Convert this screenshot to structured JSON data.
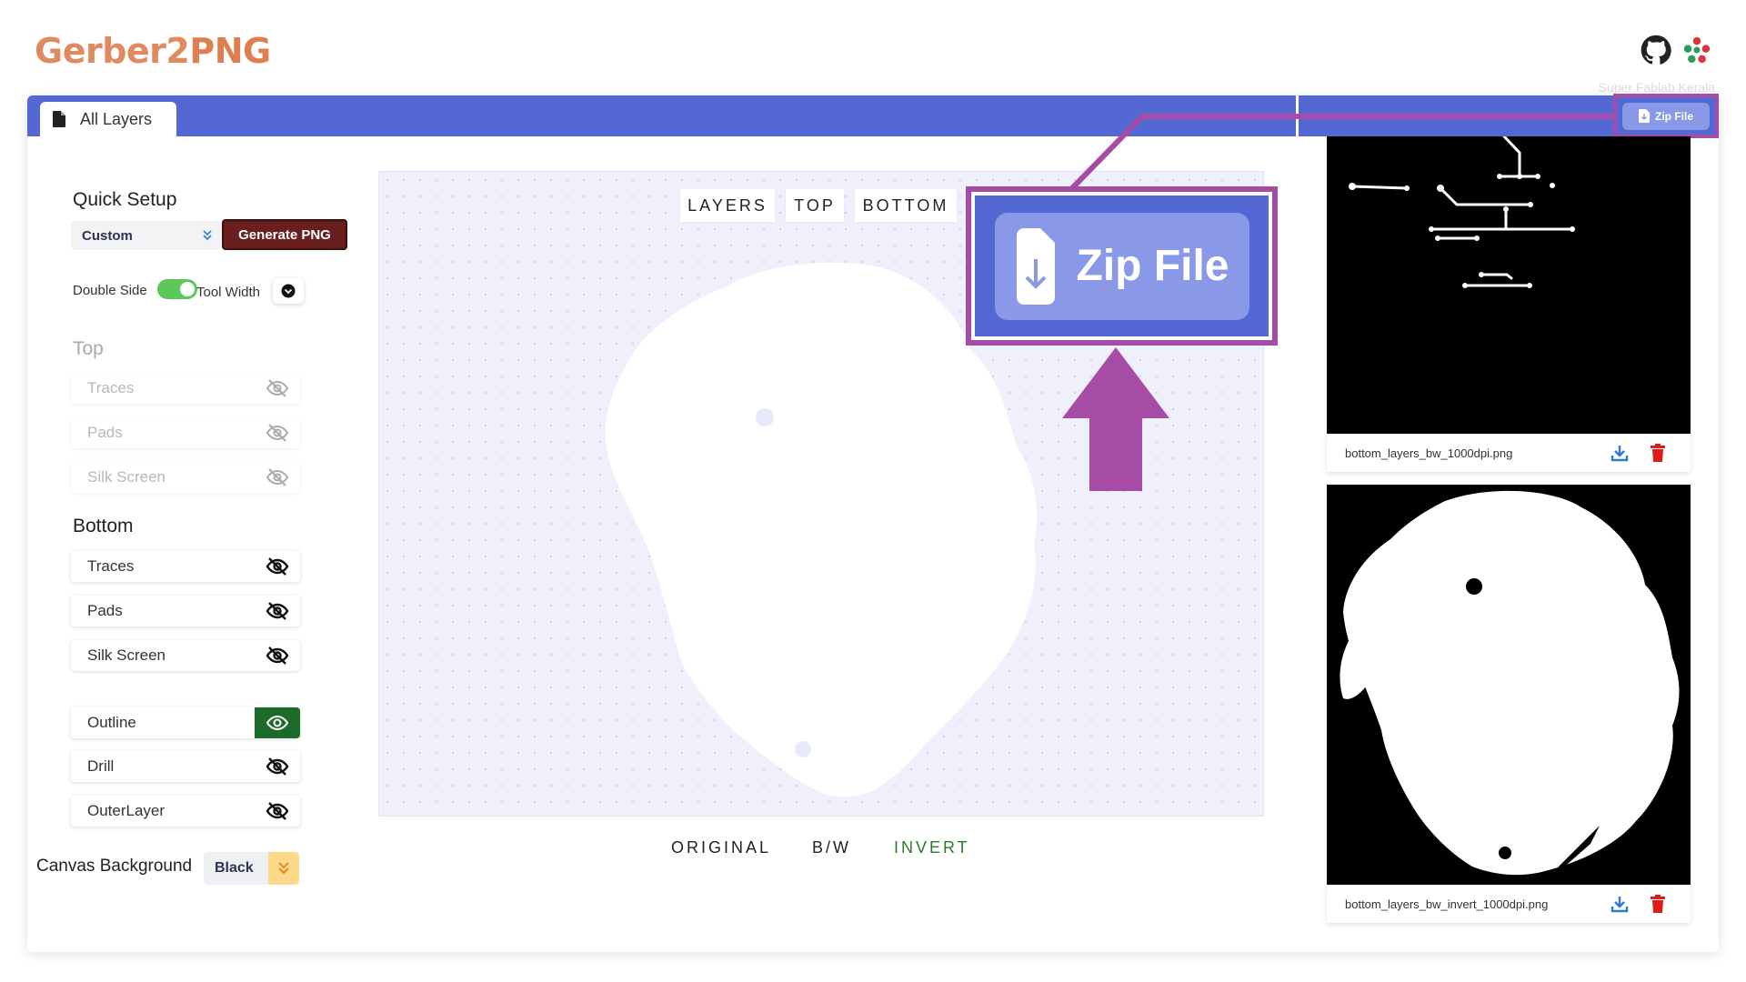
{
  "app": {
    "title_part1": "Gerber",
    "title_part2": "2",
    "title_part3": "PNG"
  },
  "header": {
    "brand_caption": "Super Fablab Kerala"
  },
  "tabs": [
    {
      "label": "All Layers"
    }
  ],
  "toolbar": {
    "zip_label": "Zip File"
  },
  "quick_setup": {
    "title": "Quick Setup",
    "preset": "Custom",
    "generate_label": "Generate PNG",
    "double_side_label": "Double Side",
    "double_side_on": true,
    "tool_width_label": "Tool Width"
  },
  "top_section": {
    "title": "Top",
    "layers": [
      {
        "label": "Traces",
        "visible": false
      },
      {
        "label": "Pads",
        "visible": false
      },
      {
        "label": "Silk Screen",
        "visible": false
      }
    ]
  },
  "bottom_section": {
    "title": "Bottom",
    "layers": [
      {
        "label": "Traces",
        "visible": false
      },
      {
        "label": "Pads",
        "visible": false
      },
      {
        "label": "Silk Screen",
        "visible": false
      }
    ]
  },
  "other_layers": [
    {
      "label": "Outline",
      "visible": true
    },
    {
      "label": "Drill",
      "visible": false
    },
    {
      "label": "OuterLayer",
      "visible": false
    }
  ],
  "canvas_background": {
    "label": "Canvas Background",
    "value": "Black"
  },
  "view_buttons": [
    "LAYERS",
    "TOP",
    "BOTTOM"
  ],
  "mode_buttons": [
    {
      "label": "ORIGINAL",
      "active": false
    },
    {
      "label": "B/W",
      "active": false
    },
    {
      "label": "INVERT",
      "active": true
    }
  ],
  "callout": {
    "label": "Zip File"
  },
  "files": [
    {
      "name": "bottom_layers_bw_1000dpi.png"
    },
    {
      "name": "bottom_layers_bw_invert_1000dpi.png"
    }
  ],
  "colors": {
    "accent": "#5468d4",
    "zip_button": "#8a98e8",
    "highlight": "#a64ca6",
    "generate": "#6a1f1f",
    "logo": "#e08a5f",
    "outline_on": "#1e6a2a"
  }
}
